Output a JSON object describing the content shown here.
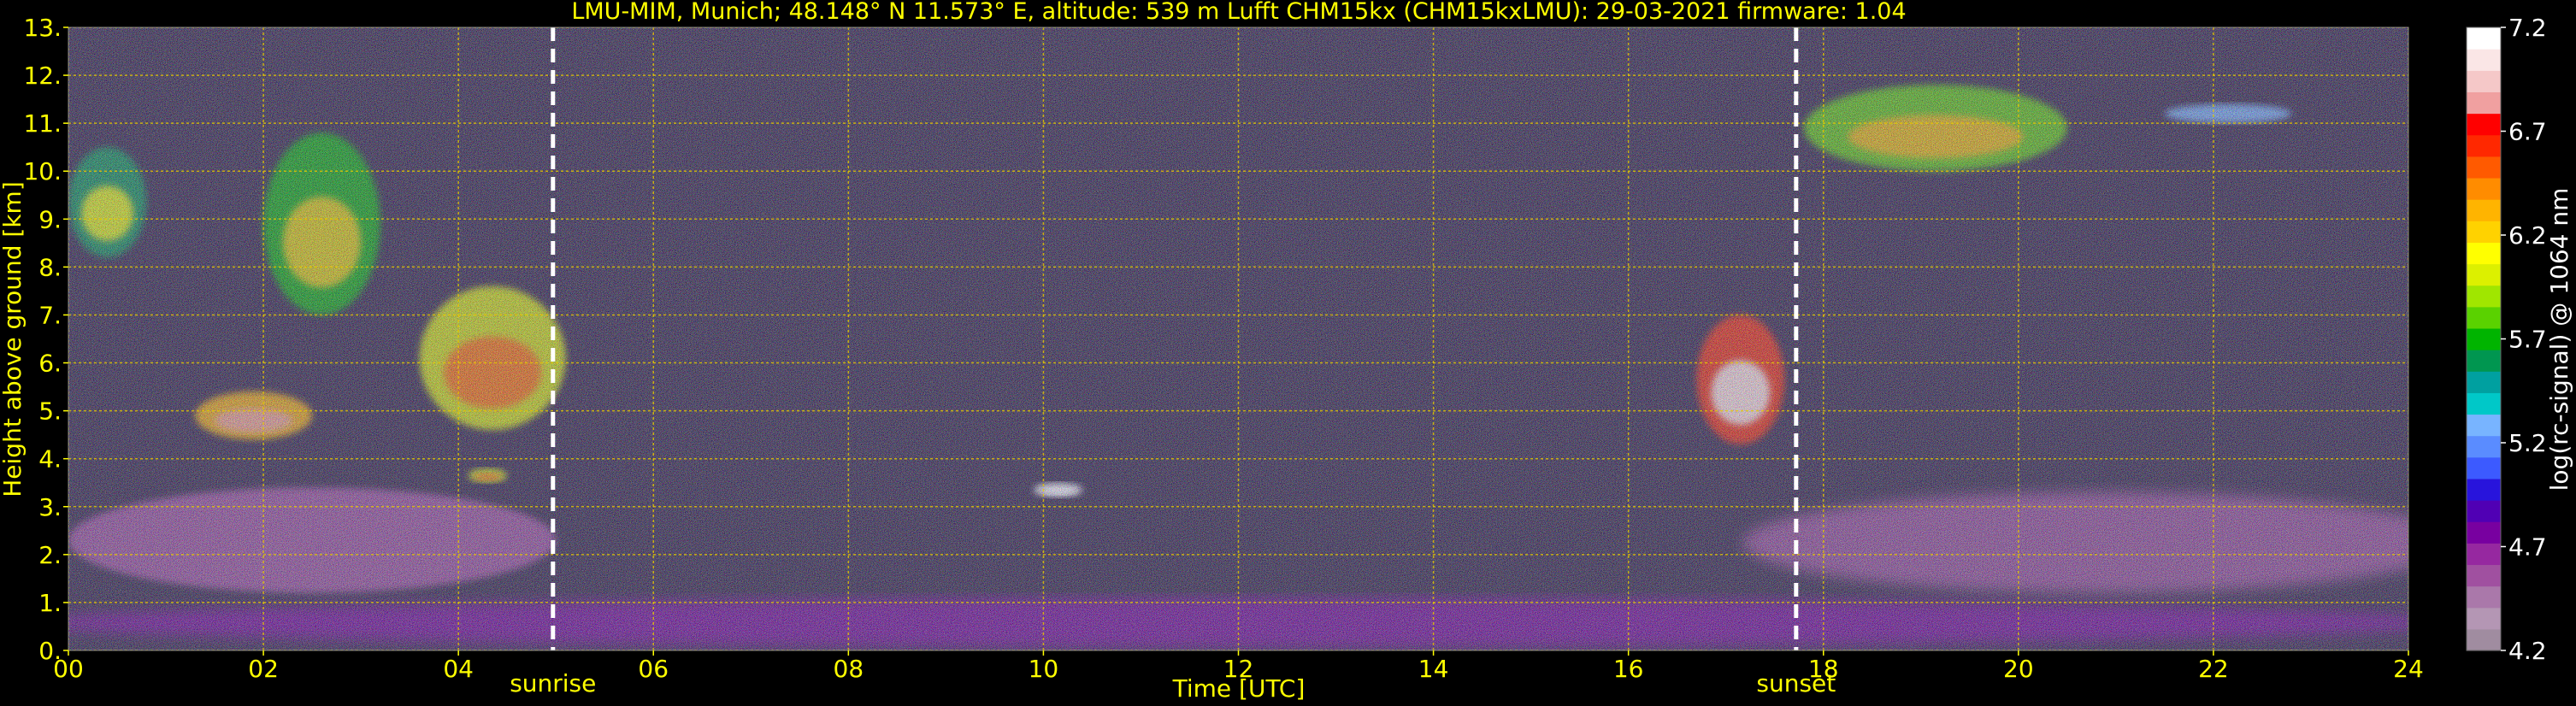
{
  "chart_data": {
    "type": "heatmap",
    "title": "LMU-MIM, Munich; 48.148° N 11.573° E, altitude: 539 m    Lufft CHM15kx (CHM15kxLMU): 29-03-2021    firmware: 1.04",
    "xlabel": "Time [UTC]",
    "ylabel": "Height above ground [km]",
    "colorbar_label": "log(rc-signal) @ 1064 nm",
    "xlim": [
      0,
      24
    ],
    "ylim": [
      0,
      13
    ],
    "clim": [
      4.2,
      7.2
    ],
    "grid": true,
    "x_ticks": [
      "00",
      "02",
      "04",
      "06",
      "08",
      "10",
      "12",
      "14",
      "16",
      "18",
      "20",
      "22",
      "24"
    ],
    "y_ticks": [
      "0.",
      "1.",
      "2.",
      "3.",
      "4.",
      "5.",
      "6.",
      "7.",
      "8.",
      "9.",
      "10.",
      "11.",
      "12.",
      "13."
    ],
    "colorbar_ticks": [
      "4.2",
      "4.7",
      "5.2",
      "5.7",
      "6.2",
      "6.7",
      "7.2"
    ],
    "colorbar_colors": [
      "#a08ca0",
      "#b496b4",
      "#aa78aa",
      "#a050a0",
      "#9628a0",
      "#7800a0",
      "#5000b4",
      "#2814dc",
      "#3c5aff",
      "#5a8cff",
      "#78b4ff",
      "#00c8c8",
      "#00a0a0",
      "#009650",
      "#00b400",
      "#5ad200",
      "#a0e600",
      "#dcf000",
      "#ffff00",
      "#ffd200",
      "#ffb400",
      "#ff8c00",
      "#ff5a00",
      "#ff2800",
      "#ff0000",
      "#f0a0a0",
      "#f5c8c8",
      "#fae6e6",
      "#ffffff"
    ],
    "markers": [
      {
        "label": "sunrise",
        "x": 4.97
      },
      {
        "label": "sunset",
        "x": 17.72
      }
    ],
    "features": [
      {
        "name": "boundary layer",
        "x": [
          0,
          24
        ],
        "y": [
          0.05,
          1.1
        ],
        "value": 4.75
      },
      {
        "name": "aerosol layer",
        "x": [
          0,
          5
        ],
        "y": [
          1.2,
          3.4
        ],
        "value": 4.6
      },
      {
        "name": "aerosol layer",
        "x": [
          17.7,
          24
        ],
        "y": [
          1.2,
          3.3
        ],
        "value": 4.6
      },
      {
        "name": "cirrus",
        "x": [
          0,
          0.8
        ],
        "y": [
          8.2,
          10.5
        ],
        "value": 5.6
      },
      {
        "name": "cirrus",
        "x": [
          2.0,
          3.2
        ],
        "y": [
          7.0,
          10.8
        ],
        "value": 5.7
      },
      {
        "name": "cloud",
        "x": [
          3.6,
          5.1
        ],
        "y": [
          4.6,
          7.6
        ],
        "value": 6.0
      },
      {
        "name": "cloud",
        "x": [
          1.3,
          2.5
        ],
        "y": [
          4.4,
          5.4
        ],
        "value": 6.3
      },
      {
        "name": "cloud",
        "x": [
          4.1,
          4.5
        ],
        "y": [
          3.5,
          3.8
        ],
        "value": 6.0
      },
      {
        "name": "cloud",
        "x": [
          9.9,
          10.4
        ],
        "y": [
          3.2,
          3.5
        ],
        "value": 7.2
      },
      {
        "name": "cloud",
        "x": [
          16.7,
          17.6
        ],
        "y": [
          4.3,
          7.0
        ],
        "value": 6.6
      },
      {
        "name": "cirrus",
        "x": [
          17.8,
          20.5
        ],
        "y": [
          10.0,
          11.8
        ],
        "value": 5.8
      },
      {
        "name": "cirrus",
        "x": [
          21.5,
          22.8
        ],
        "y": [
          11.0,
          11.4
        ],
        "value": 5.3
      }
    ]
  }
}
